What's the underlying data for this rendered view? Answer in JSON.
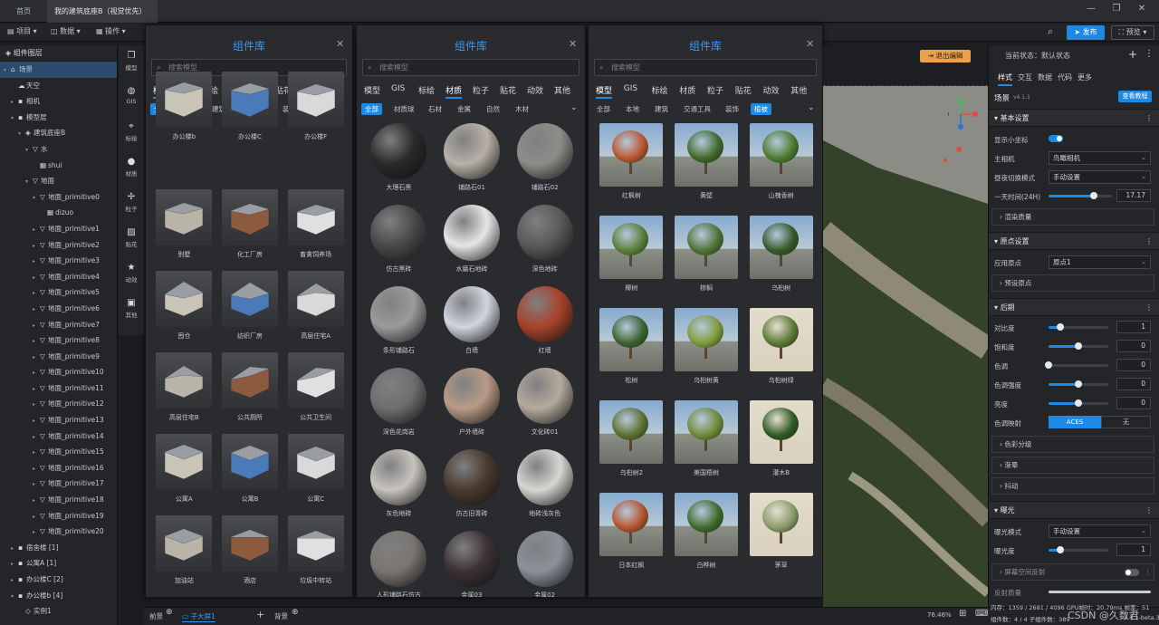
{
  "titlebar": {
    "tabs": [
      "首页",
      "我的建筑底座B（视觉优先）"
    ]
  },
  "toolbar": {
    "menus": [
      "项目",
      "数据",
      "操作"
    ],
    "publish": "发布",
    "preview": "预览"
  },
  "layers": {
    "title": "组件图层",
    "rows": [
      {
        "label": "场景",
        "depth": 0,
        "tri": "▾",
        "icon": "⌂",
        "selected": true
      },
      {
        "label": "天空",
        "depth": 1,
        "tri": "",
        "icon": "☁"
      },
      {
        "label": "相机",
        "depth": 1,
        "tri": "▸",
        "icon": "▪"
      },
      {
        "label": "模型层",
        "depth": 1,
        "tri": "▾",
        "icon": "▪"
      },
      {
        "label": "建筑底座B",
        "depth": 2,
        "tri": "▾",
        "icon": "◈"
      },
      {
        "label": "水",
        "depth": 3,
        "tri": "▾",
        "icon": "▽"
      },
      {
        "label": "shui",
        "depth": 4,
        "tri": "",
        "icon": "▦"
      },
      {
        "label": "地面",
        "depth": 3,
        "tri": "▾",
        "icon": "▽"
      },
      {
        "label": "地面_primitive0",
        "depth": 4,
        "tri": "▾",
        "icon": "▽"
      },
      {
        "label": "dizuo",
        "depth": 5,
        "tri": "",
        "icon": "▦"
      },
      {
        "label": "地面_primitive1",
        "depth": 4,
        "tri": "▸",
        "icon": "▽"
      },
      {
        "label": "地面_primitive2",
        "depth": 4,
        "tri": "▸",
        "icon": "▽"
      },
      {
        "label": "地面_primitive3",
        "depth": 4,
        "tri": "▸",
        "icon": "▽"
      },
      {
        "label": "地面_primitive4",
        "depth": 4,
        "tri": "▸",
        "icon": "▽"
      },
      {
        "label": "地面_primitive5",
        "depth": 4,
        "tri": "▸",
        "icon": "▽"
      },
      {
        "label": "地面_primitive6",
        "depth": 4,
        "tri": "▸",
        "icon": "▽"
      },
      {
        "label": "地面_primitive7",
        "depth": 4,
        "tri": "▸",
        "icon": "▽"
      },
      {
        "label": "地面_primitive8",
        "depth": 4,
        "tri": "▸",
        "icon": "▽"
      },
      {
        "label": "地面_primitive9",
        "depth": 4,
        "tri": "▸",
        "icon": "▽"
      },
      {
        "label": "地面_primitive10",
        "depth": 4,
        "tri": "▸",
        "icon": "▽"
      },
      {
        "label": "地面_primitive11",
        "depth": 4,
        "tri": "▸",
        "icon": "▽"
      },
      {
        "label": "地面_primitive12",
        "depth": 4,
        "tri": "▸",
        "icon": "▽"
      },
      {
        "label": "地面_primitive13",
        "depth": 4,
        "tri": "▸",
        "icon": "▽"
      },
      {
        "label": "地面_primitive14",
        "depth": 4,
        "tri": "▸",
        "icon": "▽"
      },
      {
        "label": "地面_primitive15",
        "depth": 4,
        "tri": "▸",
        "icon": "▽"
      },
      {
        "label": "地面_primitive16",
        "depth": 4,
        "tri": "▸",
        "icon": "▽"
      },
      {
        "label": "地面_primitive17",
        "depth": 4,
        "tri": "▸",
        "icon": "▽"
      },
      {
        "label": "地面_primitive18",
        "depth": 4,
        "tri": "▸",
        "icon": "▽"
      },
      {
        "label": "地面_primitive19",
        "depth": 4,
        "tri": "▸",
        "icon": "▽"
      },
      {
        "label": "地面_primitive20",
        "depth": 4,
        "tri": "▸",
        "icon": "▽"
      },
      {
        "label": "宿舍楼 [1]",
        "depth": 1,
        "tri": "▸",
        "icon": "▪"
      },
      {
        "label": "公寓A [1]",
        "depth": 1,
        "tri": "▸",
        "icon": "▪"
      },
      {
        "label": "办公楼C [2]",
        "depth": 1,
        "tri": "▸",
        "icon": "▪"
      },
      {
        "label": "办公楼b [4]",
        "depth": 1,
        "tri": "▾",
        "icon": "▪"
      },
      {
        "label": "实例1",
        "depth": 2,
        "tri": "",
        "icon": "◇"
      }
    ]
  },
  "strip": [
    {
      "label": "模型",
      "icon": "❒"
    },
    {
      "label": "GIS",
      "icon": "◍"
    },
    {
      "label": "标绘",
      "icon": "⌖"
    },
    {
      "label": "材质",
      "icon": "●"
    },
    {
      "label": "粒子",
      "icon": "✢"
    },
    {
      "label": "贴花",
      "icon": "▨"
    },
    {
      "label": "动效",
      "icon": "★"
    },
    {
      "label": "其他",
      "icon": "▣"
    }
  ],
  "panels": [
    {
      "title": "组件库",
      "search_placeholder": "搜索模型",
      "cats": [
        "模型",
        "GIS",
        "标绘",
        "材质",
        "粒子",
        "贴花",
        "动效",
        "其他"
      ],
      "cat_on": 0,
      "subs": [
        "全部",
        "本地",
        "建筑",
        "交通工具",
        "装饰",
        "植被"
      ],
      "sub_on": 0,
      "items": [
        [
          "办公楼b",
          "办公楼C",
          "办公楼F"
        ],
        [
          "别墅",
          "化工厂房",
          "畜禽饲养场"
        ],
        [
          "囤仓",
          "纺织厂房",
          "高层住宅A"
        ],
        [
          "高层住宅B",
          "公共厕所",
          "公共卫生间"
        ],
        [
          "公寓A",
          "公寓B",
          "公寓C"
        ],
        [
          "加油站",
          "酒店",
          "垃圾中转站"
        ]
      ]
    },
    {
      "title": "组件库",
      "search_placeholder": "搜索模型",
      "cats": [
        "模型",
        "GIS",
        "标绘",
        "材质",
        "粒子",
        "贴花",
        "动效",
        "其他"
      ],
      "cat_on": 3,
      "subs": [
        "全部",
        "材质球",
        "石材",
        "金属",
        "自然",
        "木材"
      ],
      "sub_on": 0,
      "items": [
        [
          "大理石黑",
          "铺路石01",
          "铺路石02"
        ],
        [
          "仿古黑砖",
          "水磨石地砖",
          "深色地砖"
        ],
        [
          "条形铺路石",
          "白墙",
          "红墙"
        ],
        [
          "深色花岗岩",
          "户外墙砖",
          "文化砖01"
        ],
        [
          "灰色地砖",
          "仿古旧青砖",
          "地砖浅灰色"
        ],
        [
          "人形铺路石仿古",
          "金属03",
          "金属02"
        ]
      ]
    },
    {
      "title": "组件库",
      "search_placeholder": "搜索模型",
      "cats": [
        "模型",
        "GIS",
        "标绘",
        "材质",
        "粒子",
        "贴花",
        "动效",
        "其他"
      ],
      "cat_on": 0,
      "subs": [
        "全部",
        "本地",
        "建筑",
        "交通工具",
        "装饰",
        "植被"
      ],
      "sub_on": 5,
      "items": [
        [
          "红枫树",
          "黄壁",
          "山槐香树"
        ],
        [
          "椰树",
          "棕榈",
          "乌桕树"
        ],
        [
          "松树",
          "乌桕树黄",
          "乌桕树绿"
        ],
        [
          "乌桕树2",
          "美国梧树",
          "灌木B"
        ],
        [
          "日本红枫",
          "白桦树",
          "茅草"
        ]
      ]
    }
  ],
  "viewport": {
    "exit_edit": "退出编辑",
    "zoom": "76.46%"
  },
  "right": {
    "state_label": "当前状态：默认状态",
    "tabs": [
      "样式",
      "交互",
      "数据",
      "代码",
      "更多"
    ],
    "scene_title": "场景",
    "version": "v4.1.1",
    "tutorial": "查看教程",
    "basic": "基本设置",
    "show_axis": "显示小坐标",
    "main_camera": "主相机",
    "main_camera_val": "鸟瞰相机",
    "daynight": "昼夜切换模式",
    "daynight_val": "手动设置",
    "time": "一天时间(24H)",
    "time_val": "17.17",
    "time_frac": 0.72,
    "render_quality": "渲染质量",
    "origin": "原点设置",
    "app_origin": "应用原点",
    "app_origin_val": "原点1",
    "preset_origin": "预设原点",
    "post": "后期",
    "contrast": "对比度",
    "contrast_val": "1",
    "contrast_frac": 0.2,
    "saturation": "饱和度",
    "saturation_val": "0",
    "saturation_frac": 0.5,
    "hue": "色调",
    "hue_val": "0",
    "hue_frac": 0.0,
    "hue_strength": "色调强度",
    "hue_strength_val": "0",
    "hue_strength_frac": 0.5,
    "brightness": "亮度",
    "brightness_val": "0",
    "brightness_frac": 0.5,
    "tonemap": "色调映射",
    "tonemap_on": "ACES",
    "tonemap_off": "无",
    "color_grade": "色彩分级",
    "vignette": "渐晕",
    "dither": "抖动",
    "exposure": "曝光",
    "exposure_mode": "曝光模式",
    "exposure_mode_val": "手动设置",
    "exposure_level": "曝光度",
    "exposure_level_val": "1",
    "exposure_frac": 0.2,
    "ssr": "屏幕空间反射",
    "reflect_quality": "反射质量"
  },
  "bottom": {
    "front": "前景",
    "child": "子大屏1",
    "back": "背景",
    "mem": "内存：1359 / 2681 / 4096 GPU帧时：20.79ms 帧率：51",
    "count": "组件数：4 / 4   子组件数：389",
    "watermark": "CSDN @久数君",
    "build": "4.1.1-beta.3"
  },
  "colors": {
    "accent": "#1e88e5",
    "title": "#3b98f5",
    "exit": "#e9a24b"
  }
}
